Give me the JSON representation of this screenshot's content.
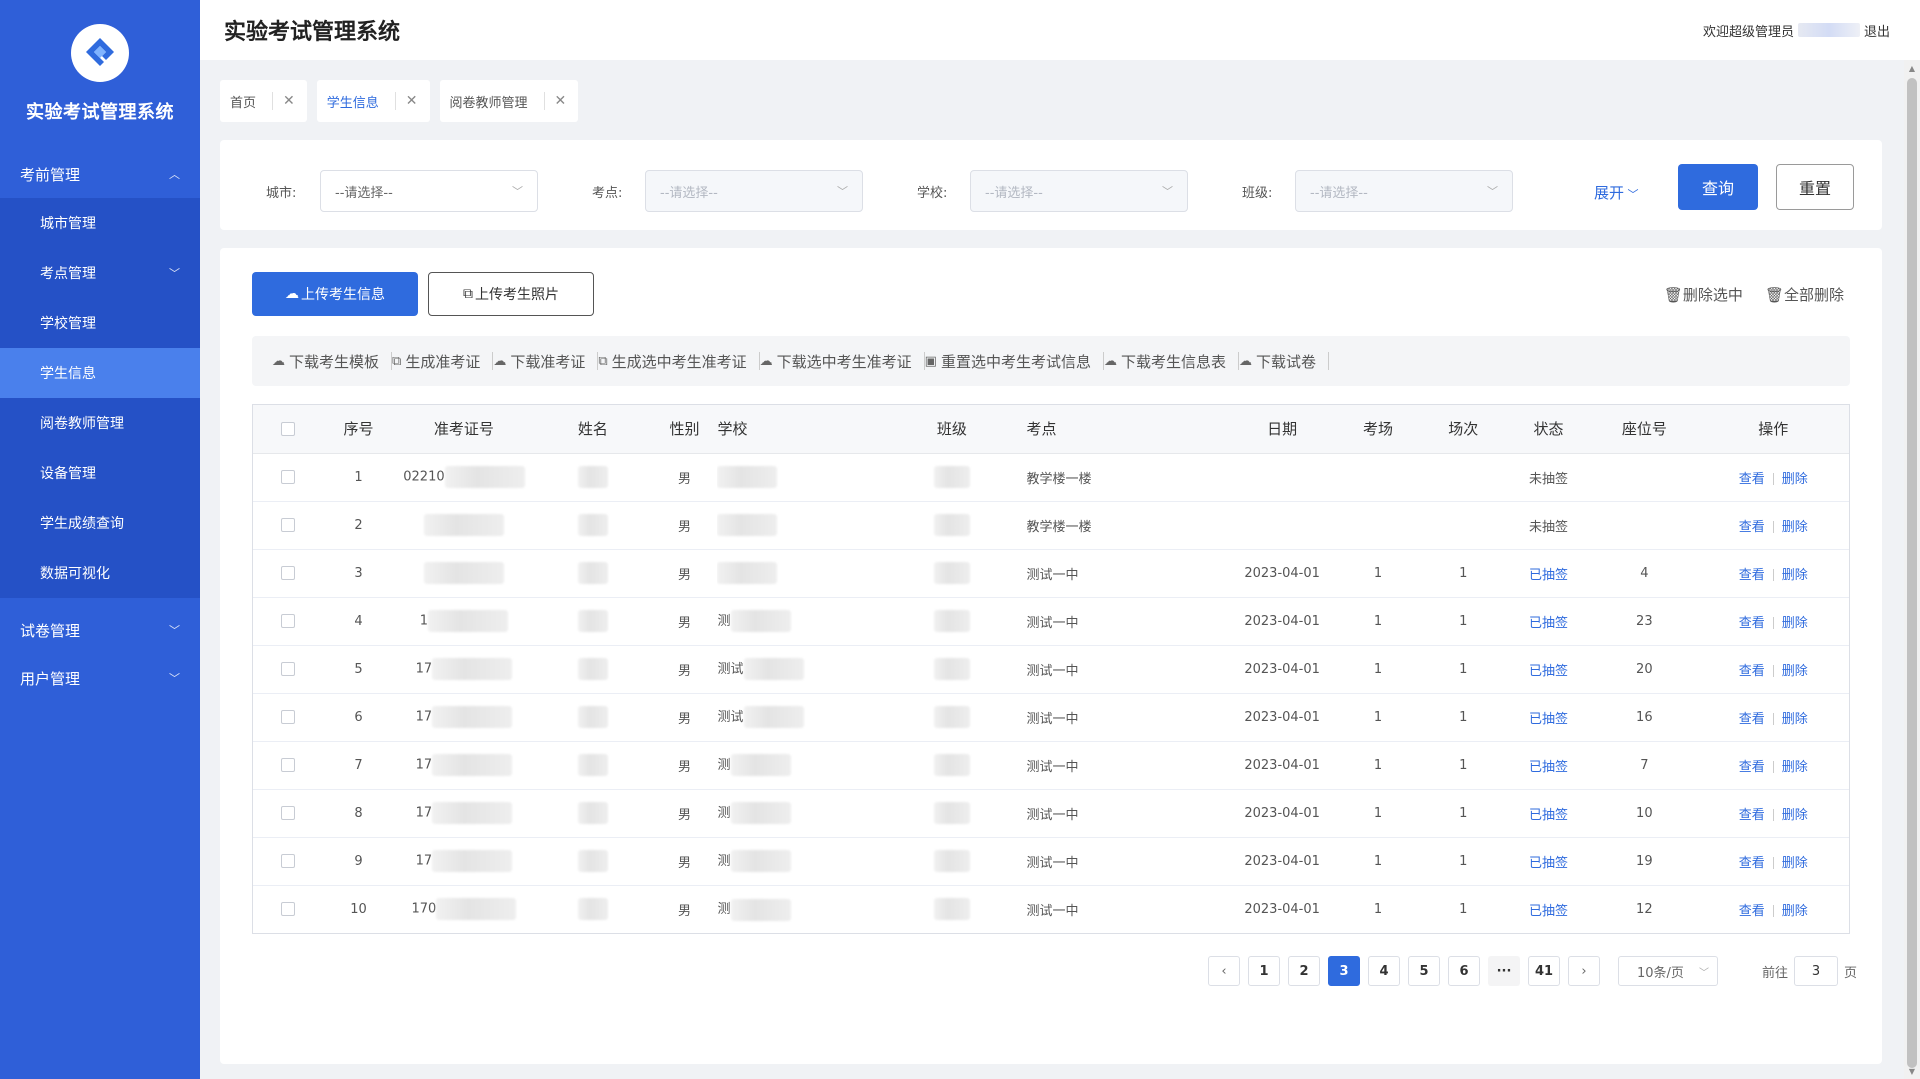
{
  "app": {
    "title": "实验考试管理系统"
  },
  "sidebar": {
    "brand": "实验考试管理系统",
    "groups": [
      {
        "label": "考前管理",
        "expanded": true
      },
      {
        "label": "试卷管理",
        "expanded": false
      },
      {
        "label": "用户管理",
        "expanded": false
      }
    ],
    "sub_items": [
      "城市管理",
      "考点管理",
      "学校管理",
      "学生信息",
      "阅卷教师管理",
      "设备管理",
      "学生成绩查询",
      "数据可视化"
    ],
    "active": "学生信息"
  },
  "header": {
    "title": "实验考试管理系统",
    "welcome": "欢迎超级管理员",
    "logout": "退出"
  },
  "tabs": [
    {
      "label": "首页"
    },
    {
      "label": "学生信息",
      "active": true
    },
    {
      "label": "阅卷教师管理"
    }
  ],
  "filters": {
    "city_label": "城市:",
    "site_label": "考点:",
    "school_label": "学校:",
    "class_label": "班级:",
    "placeholder": "--请选择--",
    "expand": "展开",
    "query": "查询",
    "reset": "重置"
  },
  "actions": {
    "upload_info": "上传考生信息",
    "upload_photo": "上传考生照片",
    "delete_selected": "删除选中",
    "delete_all": "全部删除"
  },
  "toolbar": {
    "items": [
      "下载考生模板",
      "生成准考证",
      "下载准考证",
      "生成选中考生准考证",
      "下载选中考生准考证",
      "重置选中考生考试信息",
      "下载考生信息表",
      "下载试卷"
    ]
  },
  "table": {
    "headers": [
      "序号",
      "准考证号",
      "姓名",
      "性别",
      "学校",
      "班级",
      "考点",
      "日期",
      "考场",
      "场次",
      "状态",
      "座位号",
      "操作"
    ],
    "rows": [
      {
        "no": "1",
        "ticket": "02210",
        "gender": "男",
        "school": "",
        "site": "教学楼一楼",
        "date": "",
        "room": "",
        "session": "",
        "status": "未抽签",
        "seat": ""
      },
      {
        "no": "2",
        "ticket": "",
        "gender": "男",
        "school": "",
        "site": "教学楼一楼",
        "date": "",
        "room": "",
        "session": "",
        "status": "未抽签",
        "seat": ""
      },
      {
        "no": "3",
        "ticket": "",
        "gender": "男",
        "school": "",
        "site": "测试一中",
        "date": "2023-04-01",
        "room": "1",
        "session": "1",
        "status": "已抽签",
        "seat": "4"
      },
      {
        "no": "4",
        "ticket": "1",
        "gender": "男",
        "school": "测",
        "site": "测试一中",
        "date": "2023-04-01",
        "room": "1",
        "session": "1",
        "status": "已抽签",
        "seat": "23"
      },
      {
        "no": "5",
        "ticket": "17",
        "gender": "男",
        "school": "测试",
        "site": "测试一中",
        "date": "2023-04-01",
        "room": "1",
        "session": "1",
        "status": "已抽签",
        "seat": "20"
      },
      {
        "no": "6",
        "ticket": "17",
        "gender": "男",
        "school": "测试",
        "site": "测试一中",
        "date": "2023-04-01",
        "room": "1",
        "session": "1",
        "status": "已抽签",
        "seat": "16"
      },
      {
        "no": "7",
        "ticket": "17",
        "gender": "男",
        "school": "测",
        "site": "测试一中",
        "date": "2023-04-01",
        "room": "1",
        "session": "1",
        "status": "已抽签",
        "seat": "7"
      },
      {
        "no": "8",
        "ticket": "17",
        "gender": "男",
        "school": "测",
        "site": "测试一中",
        "date": "2023-04-01",
        "room": "1",
        "session": "1",
        "status": "已抽签",
        "seat": "10"
      },
      {
        "no": "9",
        "ticket": "17",
        "gender": "男",
        "school": "测",
        "site": "测试一中",
        "date": "2023-04-01",
        "room": "1",
        "session": "1",
        "status": "已抽签",
        "seat": "19"
      },
      {
        "no": "10",
        "ticket": "170",
        "gender": "男",
        "school": "测",
        "site": "测试一中",
        "date": "2023-04-01",
        "room": "1",
        "session": "1",
        "status": "已抽签",
        "seat": "12"
      }
    ],
    "op_view": "查看",
    "op_delete": "删除"
  },
  "pagination": {
    "pages": [
      "1",
      "2",
      "3",
      "4",
      "5",
      "6",
      "···",
      "41"
    ],
    "current": "3",
    "page_size": "10条/页",
    "goto_prefix": "前往",
    "goto_value": "3",
    "goto_suffix": "页"
  },
  "colors": {
    "primary": "#2f6bde",
    "sidebar": "#2f5fd8",
    "sidebar_active": "#4a80ec"
  }
}
